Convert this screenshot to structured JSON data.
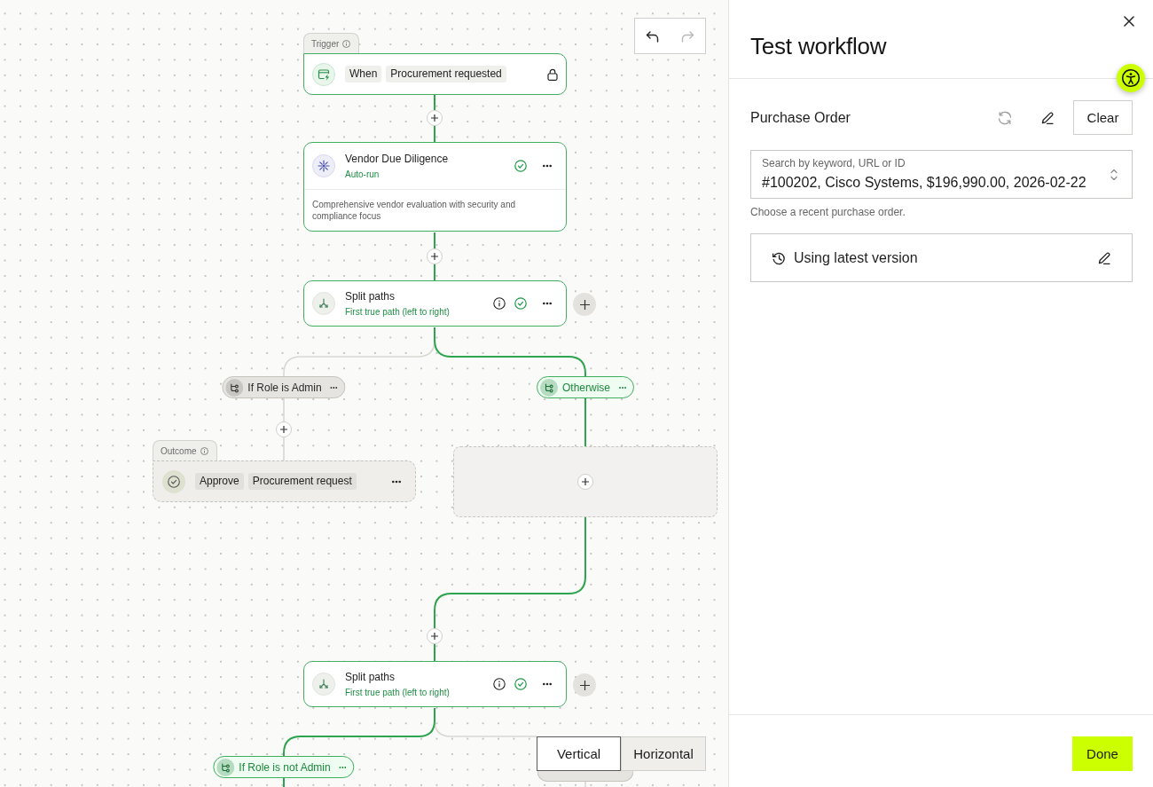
{
  "canvas": {
    "history": [
      {
        "kind": "undo",
        "disabled": false
      },
      {
        "kind": "redo",
        "disabled": true
      }
    ],
    "nodes": [
      {
        "kind": "trigger",
        "tab": "Trigger",
        "tokens": [
          "When",
          "Procurement requested"
        ],
        "locked": true,
        "reached": true
      },
      {
        "kind": "step",
        "title": "Vendor Due Diligence",
        "subtitle": "Auto-run",
        "description": "Comprehensive vendor evaluation with security and compliance focus",
        "validated": true,
        "reached": true
      },
      {
        "kind": "split",
        "title": "Split paths",
        "subtitle": "First true path (left to right)",
        "validated": true,
        "reached": true,
        "branches": [
          {
            "label": "If Role is Admin",
            "active": false,
            "children": [
              {
                "kind": "outcome",
                "tab": "Outcome",
                "tokens": [
                  "Approve",
                  "Procurement request"
                ],
                "reached": false
              }
            ]
          },
          {
            "label": "Otherwise",
            "active": true,
            "children": [
              {
                "kind": "empty"
              }
            ]
          }
        ]
      },
      {
        "kind": "split",
        "title": "Split paths",
        "subtitle": "First true path (left to right)",
        "validated": true,
        "reached": true,
        "branches": [
          {
            "label": "If Role is not Admin",
            "active": true
          },
          {
            "active": false
          }
        ]
      }
    ],
    "layout_toggle": [
      {
        "label": "Vertical",
        "selected": true
      },
      {
        "label": "Horizontal",
        "selected": false
      }
    ]
  },
  "panel": {
    "title": "Test workflow",
    "input_label": "Purchase Order",
    "refresh": {
      "disabled": true
    },
    "clear": "Clear",
    "field": {
      "label": "Search by keyword, URL or ID",
      "value": "#100202, Cisco Systems, $196,990.00, 2026-02-22"
    },
    "helper": "Choose a recent purchase order.",
    "version": "Using latest version",
    "done": "Done"
  }
}
